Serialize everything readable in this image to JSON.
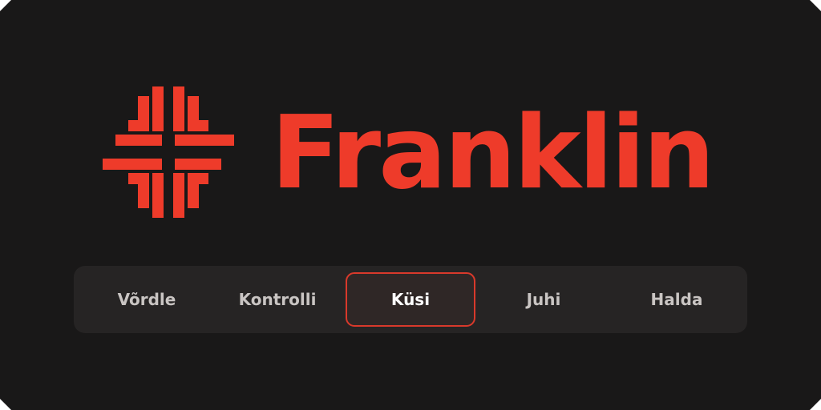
{
  "brand": {
    "name": "Franklin",
    "accent_color": "#ee3b2a",
    "logo_icon": "franklin-cross-logo"
  },
  "tabs": [
    {
      "label": "Võrdle",
      "active": false
    },
    {
      "label": "Kontrolli",
      "active": false
    },
    {
      "label": "Küsi",
      "active": true
    },
    {
      "label": "Juhi",
      "active": false
    },
    {
      "label": "Halda",
      "active": false
    }
  ],
  "colors": {
    "background": "#191818",
    "tab_bar": "#262424",
    "active_border": "#d9392b",
    "tab_text": "#c9c5c3",
    "active_tab_text": "#ffffff"
  }
}
